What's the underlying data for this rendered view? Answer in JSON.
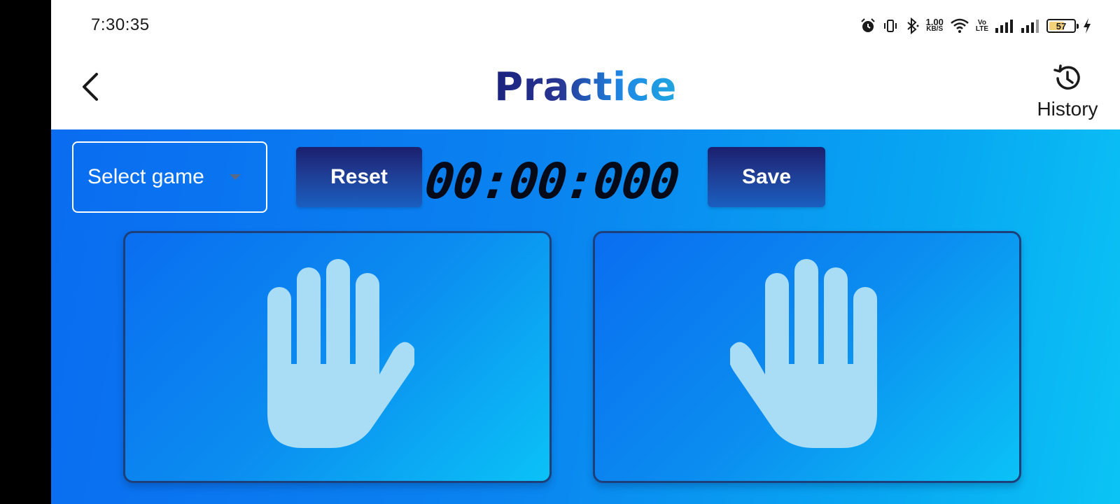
{
  "status_bar": {
    "time": "7:30:35",
    "net_speed_value": "1.00",
    "net_speed_unit": "KB/S",
    "volte_top": "Vo",
    "volte_bottom": "LTE",
    "battery_percent": "57",
    "icons": [
      "alarm-icon",
      "vibrate-icon",
      "bluetooth-icon",
      "wifi-icon",
      "signal-icon",
      "signal-icon-2",
      "charging-icon"
    ]
  },
  "app_bar": {
    "title": "Practice",
    "back_icon": "back-arrow-icon",
    "history_label": "History",
    "history_icon": "history-icon"
  },
  "controls": {
    "select_game_label": "Select game",
    "reset_label": "Reset",
    "timer": "00:00:000",
    "save_label": "Save"
  },
  "pads": [
    {
      "icon": "hand-icon"
    },
    {
      "icon": "hand-icon"
    }
  ],
  "colors": {
    "title_dark": "#1a237e",
    "title_light": "#1fa6e0",
    "main_bg_start": "#0a6cf0",
    "main_bg_end": "#0bc4f5",
    "button_dark": "#1b1f6e",
    "hand_fill": "#a9dcf5",
    "timer_color": "#050a18"
  }
}
